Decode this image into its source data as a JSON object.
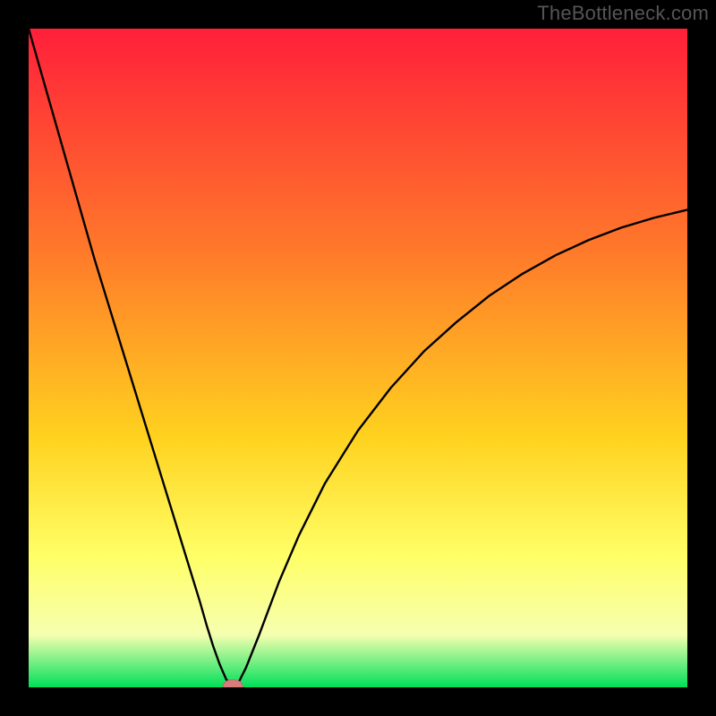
{
  "watermark": "TheBottleneck.com",
  "colors": {
    "frame": "#000000",
    "curve": "#000000",
    "marker_fill": "#d97b7b",
    "marker_stroke": "#c46a6a",
    "grad_top": "#ff1f3a",
    "grad_upper_mid": "#ff7a2a",
    "grad_mid": "#ffd21f",
    "grad_lower_mid": "#ffff66",
    "grad_pale": "#f6ffb0",
    "grad_bottom": "#00e05a"
  },
  "chart_data": {
    "type": "line",
    "title": "",
    "xlabel": "",
    "ylabel": "",
    "xlim": [
      0,
      100
    ],
    "ylim": [
      0,
      100
    ],
    "grid": false,
    "legend": false,
    "series": [
      {
        "name": "bottleneck-curve",
        "x": [
          0,
          2,
          4,
          6,
          8,
          10,
          12,
          14,
          16,
          18,
          20,
          22,
          24,
          26,
          27,
          28,
          29,
          30,
          31,
          32,
          33,
          35,
          38,
          41,
          45,
          50,
          55,
          60,
          65,
          70,
          75,
          80,
          85,
          90,
          95,
          100
        ],
        "y": [
          100,
          93,
          86,
          79,
          72,
          65,
          58.5,
          52,
          45.5,
          39,
          32.5,
          26,
          19.5,
          13,
          9.5,
          6.3,
          3.5,
          1.2,
          0.2,
          1.0,
          3.0,
          8.0,
          16.0,
          23.0,
          31.0,
          39.0,
          45.5,
          51.0,
          55.5,
          59.5,
          62.8,
          65.6,
          67.9,
          69.8,
          71.3,
          72.5
        ]
      }
    ],
    "marker": {
      "x": 31,
      "y": 0.2
    },
    "background_gradient_stops": [
      {
        "offset": 0.0,
        "color": "#ff1f3a"
      },
      {
        "offset": 0.34,
        "color": "#ff7a2a"
      },
      {
        "offset": 0.62,
        "color": "#ffd21f"
      },
      {
        "offset": 0.8,
        "color": "#ffff66"
      },
      {
        "offset": 0.92,
        "color": "#f6ffb0"
      },
      {
        "offset": 1.0,
        "color": "#00e05a"
      }
    ]
  }
}
